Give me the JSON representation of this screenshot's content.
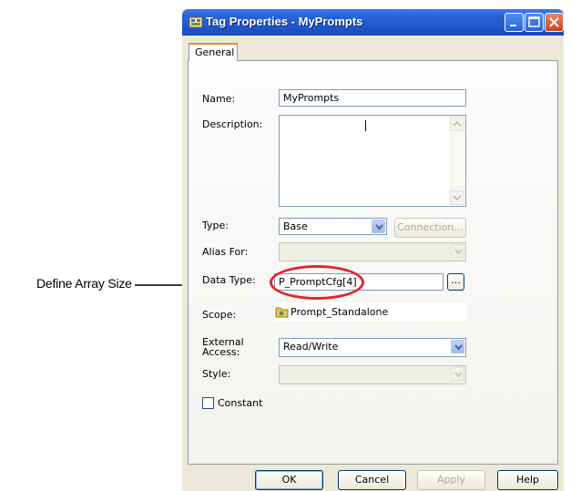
{
  "callout": {
    "text": "Define Array Size"
  },
  "window": {
    "title": "Tag Properties - MyPrompts",
    "tab_general": "General",
    "name_label": "Name:",
    "name_value": "MyPrompts",
    "description_label": "Description:",
    "description_value": "",
    "type_label": "Type:",
    "type_value": "Base",
    "connection_label": "Connection...",
    "alias_label": "Alias For:",
    "alias_value": "",
    "datatype_label": "Data Type:",
    "datatype_value": "P_PromptCfg[4]",
    "browse_label": "...",
    "scope_label": "Scope:",
    "scope_value": "Prompt_Standalone",
    "external_access_label_1": "External",
    "external_access_label_2": "Access:",
    "external_access_value": "Read/Write",
    "style_label": "Style:",
    "style_value": "",
    "constant_label": "Constant",
    "ok_label": "OK",
    "cancel_label": "Cancel",
    "apply_label": "Apply",
    "help_label": "Help"
  },
  "colors": {
    "highlight": "#e2262b",
    "titlebar": "#2a63d8"
  },
  "icons": [
    "tag-properties-icon",
    "minimize-icon",
    "maximize-icon",
    "close-icon",
    "chevron-down-icon",
    "scroll-up-icon",
    "scroll-down-icon",
    "program-scope-icon"
  ]
}
